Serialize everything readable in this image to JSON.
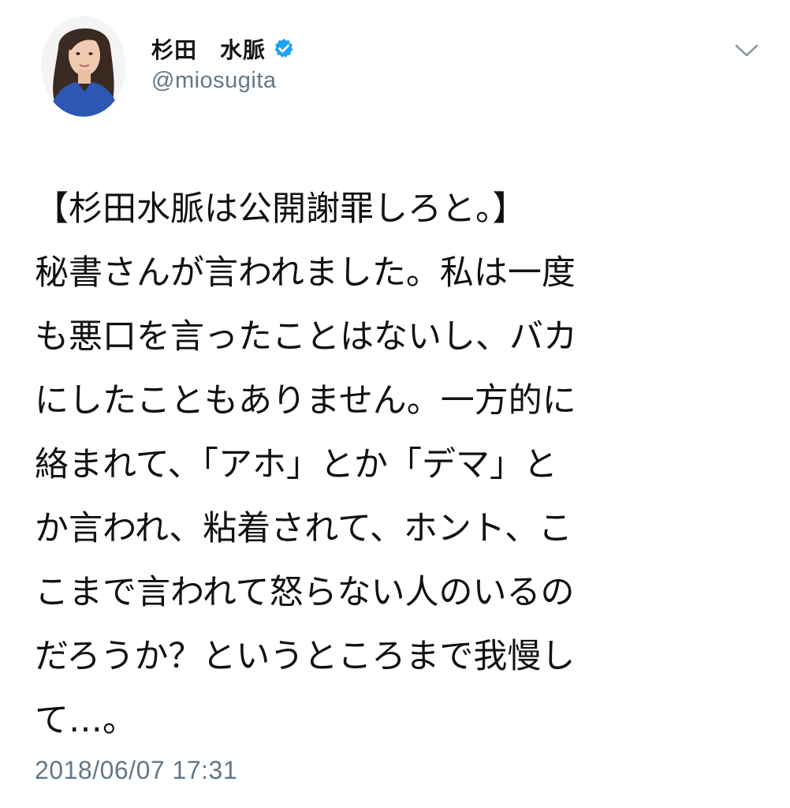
{
  "author": {
    "display_name": "杉田　水脈",
    "handle": "@miosugita",
    "verified": true,
    "avatar_icon": "profile-photo"
  },
  "menu": {
    "icon": "chevron-down-icon"
  },
  "tweet": {
    "text": "【杉田水脈は公開謝罪しろと。】\n秘書さんが言われました。私は一度\nも悪口を言ったことはないし、バカ\nにしたこともありません。一方的に\n絡まれて、「アホ」とか「デマ」と\nか言われ、粘着されて、ホント、こ\nこまで言われて怒らない人のいるの\nだろうか？というところまで我慢し\nて…。",
    "timestamp": "2018/06/07 17:31"
  },
  "colors": {
    "text": "#14171a",
    "secondary": "#657786",
    "verified_badge": "#1da1f2"
  }
}
